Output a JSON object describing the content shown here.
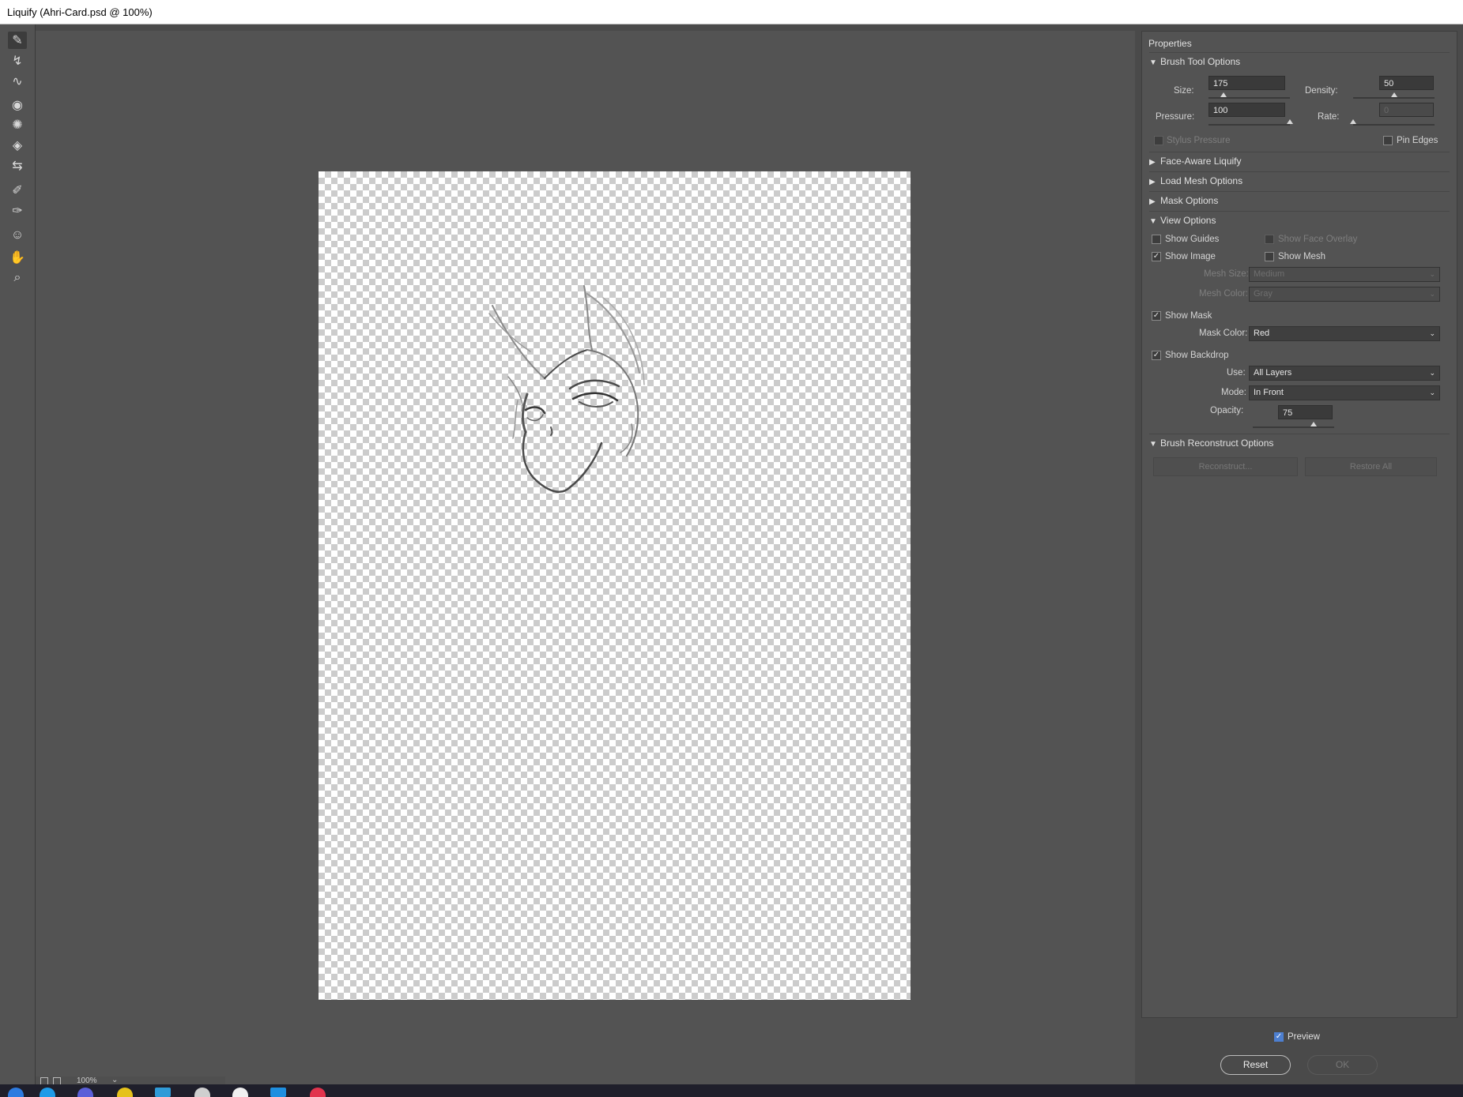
{
  "window": {
    "title": "Liquify (Ahri-Card.psd @ 100%)"
  },
  "tools": [
    {
      "name": "forward-warp-icon",
      "glyph": "✎"
    },
    {
      "name": "reconstruct-icon",
      "glyph": "↯"
    },
    {
      "name": "smooth-icon",
      "glyph": "∿"
    },
    {
      "name": "twirl-clockwise-icon",
      "glyph": "◉"
    },
    {
      "name": "pucker-icon",
      "glyph": "✺"
    },
    {
      "name": "bloat-icon",
      "glyph": "◈"
    },
    {
      "name": "push-left-icon",
      "glyph": "⇆"
    },
    {
      "name": "freeze-mask-icon",
      "glyph": "✐"
    },
    {
      "name": "thaw-mask-icon",
      "glyph": "✑"
    },
    {
      "name": "face-tool-icon",
      "glyph": "☺"
    },
    {
      "name": "hand-icon",
      "glyph": "✋"
    },
    {
      "name": "zoom-icon",
      "glyph": "⌕"
    }
  ],
  "statusbar": {
    "zoom": "100%"
  },
  "panel": {
    "title": "Properties",
    "brush_tool_options": {
      "header": "Brush Tool Options",
      "size_label": "Size:",
      "size_value": "175",
      "density_label": "Density:",
      "density_value": "50",
      "pressure_label": "Pressure:",
      "pressure_value": "100",
      "rate_label": "Rate:",
      "rate_value": "0",
      "stylus_pressure": "Stylus Pressure",
      "pin_edges": "Pin Edges"
    },
    "face_aware": "Face-Aware Liquify",
    "load_mesh": "Load Mesh Options",
    "mask_options": "Mask Options",
    "view_options": {
      "header": "View Options",
      "show_guides": "Show Guides",
      "show_face_overlay": "Show Face Overlay",
      "show_image": "Show Image",
      "show_mesh": "Show Mesh",
      "mesh_size_label": "Mesh Size:",
      "mesh_size_value": "Medium",
      "mesh_color_label": "Mesh Color:",
      "mesh_color_value": "Gray",
      "show_mask": "Show Mask",
      "mask_color_label": "Mask Color:",
      "mask_color_value": "Red",
      "show_backdrop": "Show Backdrop",
      "use_label": "Use:",
      "use_value": "All Layers",
      "mode_label": "Mode:",
      "mode_value": "In Front",
      "opacity_label": "Opacity:",
      "opacity_value": "75"
    },
    "brush_reconstruct": {
      "header": "Brush Reconstruct Options",
      "reconstruct": "Reconstruct...",
      "restore_all": "Restore All"
    }
  },
  "footer": {
    "preview": "Preview",
    "reset": "Reset",
    "ok": "OK"
  },
  "sliders": {
    "size": 0.18,
    "density": 0.5,
    "pressure": 1.0,
    "rate": 0.0,
    "opacity": 0.75
  }
}
